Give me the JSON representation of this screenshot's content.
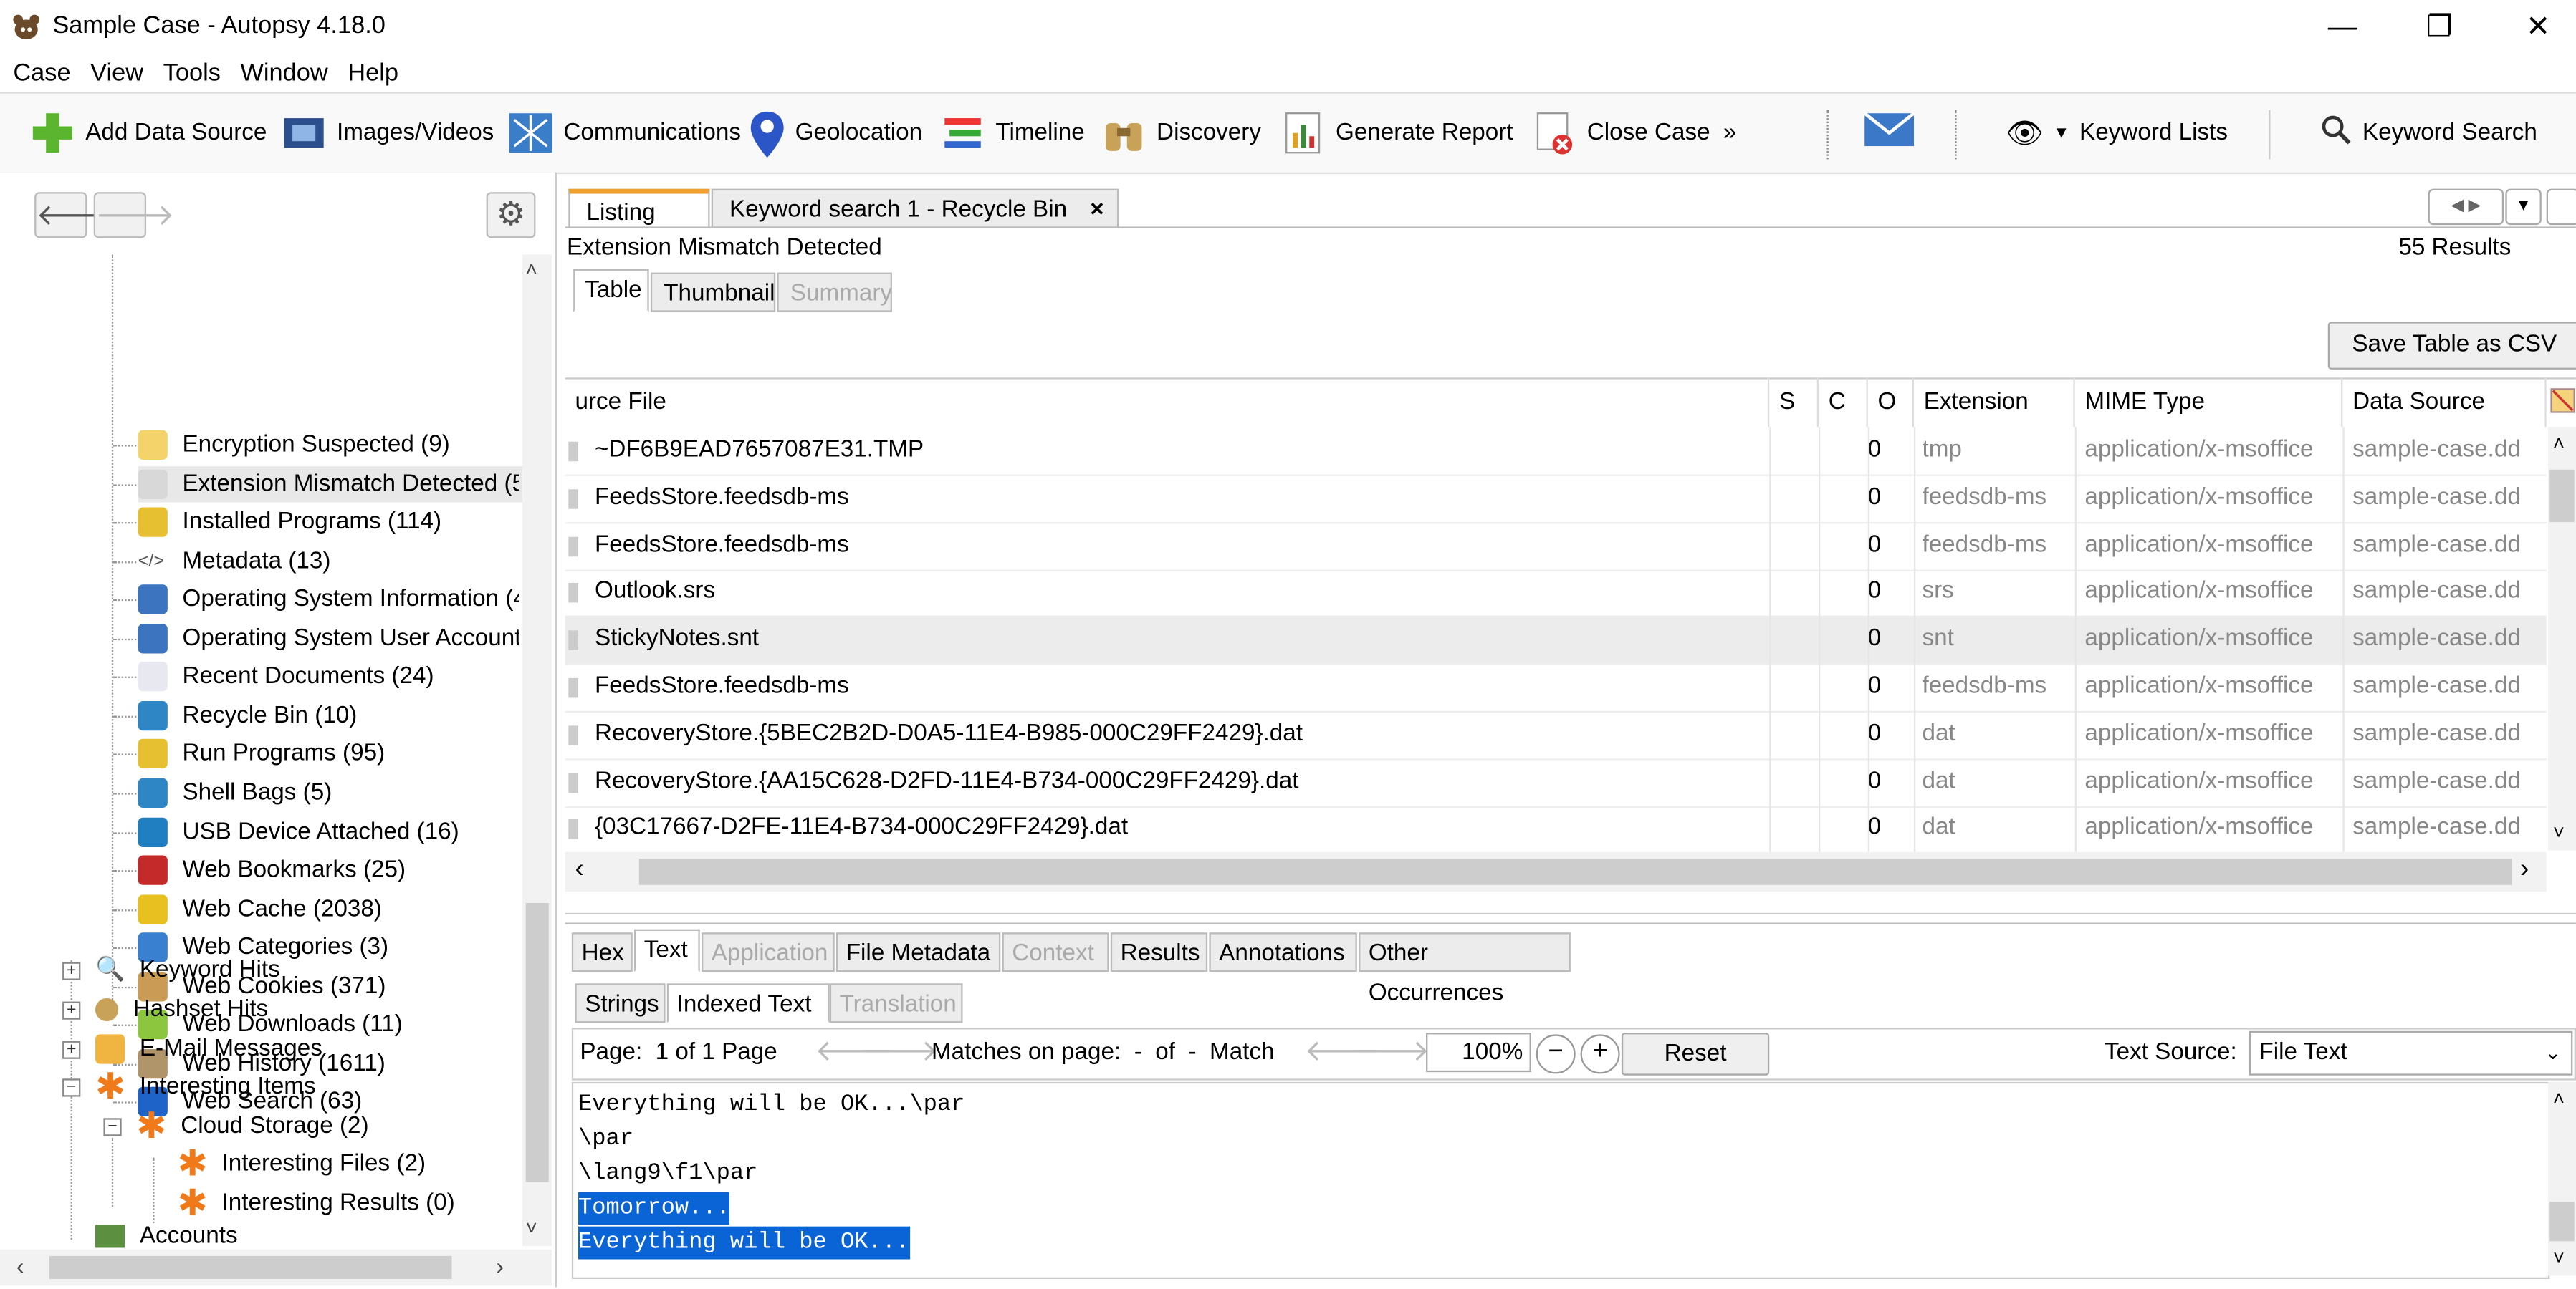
{
  "window": {
    "title": "Sample Case - Autopsy 4.18.0",
    "controls": [
      "—",
      "❐",
      "✕"
    ]
  },
  "menu": [
    "Case",
    "View",
    "Tools",
    "Window",
    "Help"
  ],
  "toolbar": {
    "add_data_source": "Add Data Source",
    "images_videos": "Images/Videos",
    "communications": "Communications",
    "geolocation": "Geolocation",
    "timeline": "Timeline",
    "discovery": "Discovery",
    "generate_report": "Generate Report",
    "close_case": "Close Case",
    "more": "»",
    "keyword_lists": "Keyword Lists",
    "keyword_search": "Keyword Search"
  },
  "tree": {
    "items": [
      {
        "label": "Encryption Suspected (9)",
        "icon": "encryption-icon"
      },
      {
        "label": "Extension Mismatch Detected (5",
        "icon": "mismatch-icon"
      },
      {
        "label": "Installed Programs (114)",
        "icon": "installed-programs-icon"
      },
      {
        "label": "Metadata (13)",
        "icon": "metadata-icon"
      },
      {
        "label": "Operating System Information (4",
        "icon": "os-info-icon"
      },
      {
        "label": "Operating System User Account",
        "icon": "os-user-icon"
      },
      {
        "label": "Recent Documents (24)",
        "icon": "recent-docs-icon"
      },
      {
        "label": "Recycle Bin (10)",
        "icon": "recycle-bin-icon"
      },
      {
        "label": "Run Programs (95)",
        "icon": "run-programs-icon"
      },
      {
        "label": "Shell Bags (5)",
        "icon": "shell-bags-icon"
      },
      {
        "label": "USB Device Attached (16)",
        "icon": "usb-icon"
      },
      {
        "label": "Web Bookmarks (25)",
        "icon": "bookmark-icon"
      },
      {
        "label": "Web Cache (2038)",
        "icon": "web-cache-icon"
      },
      {
        "label": "Web Categories (3)",
        "icon": "web-categories-icon"
      },
      {
        "label": "Web Cookies (371)",
        "icon": "cookie-icon"
      },
      {
        "label": "Web Downloads (11)",
        "icon": "download-icon"
      },
      {
        "label": "Web History (1611)",
        "icon": "hourglass-icon"
      },
      {
        "label": "Web Search (63)",
        "icon": "web-search-icon"
      }
    ],
    "groups": [
      {
        "label": "Keyword Hits",
        "icon": "magnifier-icon"
      },
      {
        "label": "Hashset Hits",
        "icon": "pin-icon"
      },
      {
        "label": "E-Mail Messages",
        "icon": "email-icon"
      },
      {
        "label": "Interesting Items",
        "icon": "asterisk-icon"
      }
    ],
    "cloud_storage": "Cloud Storage (2)",
    "interesting_files": "Interesting Files (2)",
    "interesting_results": "Interesting Results (0)",
    "accounts": "Accounts"
  },
  "tabs": {
    "listing": "Listing",
    "keyword_search": "Keyword search 1 - Recycle Bin",
    "close": "×"
  },
  "listing": {
    "title": "Extension Mismatch Detected",
    "results": "55  Results",
    "view_tabs": [
      "Table",
      "Thumbnail",
      "Summary"
    ],
    "save_csv": "Save Table as CSV",
    "columns": [
      "urce File",
      "S",
      "C",
      "O",
      "Extension",
      "MIME Type",
      "Data Source"
    ],
    "rows": [
      {
        "file": "~DF6B9EAD7657087E31.TMP",
        "o": "0",
        "ext": "tmp",
        "mime": "application/x-msoffice",
        "ds": "sample-case.dd"
      },
      {
        "file": "FeedsStore.feedsdb-ms",
        "o": "0",
        "ext": "feedsdb-ms",
        "mime": "application/x-msoffice",
        "ds": "sample-case.dd"
      },
      {
        "file": "FeedsStore.feedsdb-ms",
        "o": "0",
        "ext": "feedsdb-ms",
        "mime": "application/x-msoffice",
        "ds": "sample-case.dd"
      },
      {
        "file": "Outlook.srs",
        "o": "0",
        "ext": "srs",
        "mime": "application/x-msoffice",
        "ds": "sample-case.dd"
      },
      {
        "file": "StickyNotes.snt",
        "o": "0",
        "ext": "snt",
        "mime": "application/x-msoffice",
        "ds": "sample-case.dd"
      },
      {
        "file": "FeedsStore.feedsdb-ms",
        "o": "0",
        "ext": "feedsdb-ms",
        "mime": "application/x-msoffice",
        "ds": "sample-case.dd"
      },
      {
        "file": "RecoveryStore.{5BEC2B2D-D0A5-11E4-B985-000C29FF2429}.dat",
        "o": "0",
        "ext": "dat",
        "mime": "application/x-msoffice",
        "ds": "sample-case.dd"
      },
      {
        "file": "RecoveryStore.{AA15C628-D2FD-11E4-B734-000C29FF2429}.dat",
        "o": "0",
        "ext": "dat",
        "mime": "application/x-msoffice",
        "ds": "sample-case.dd"
      },
      {
        "file": "{03C17667-D2FE-11E4-B734-000C29FF2429}.dat",
        "o": "0",
        "ext": "dat",
        "mime": "application/x-msoffice",
        "ds": "sample-case.dd"
      }
    ]
  },
  "content": {
    "tabs": [
      "Hex",
      "Text",
      "Application",
      "File Metadata",
      "Context",
      "Results",
      "Annotations",
      "Other Occurrences"
    ],
    "sub_tabs": [
      "Strings",
      "Indexed Text",
      "Translation"
    ],
    "page": "Page:  1 of 1 Page",
    "matches": "Matches on page:  -  of  -  Match",
    "zoom": "100%",
    "reset": "Reset",
    "text_source_label": "Text Source:",
    "text_source_value": "File Text",
    "lines": [
      "Everything will be OK...\\par",
      "\\par",
      "\\lang9\\f1\\par",
      "Tomorrow...",
      "Everything will be OK..."
    ]
  },
  "colors": {
    "selection": "#0a64d6",
    "highlight_row": "#ececec",
    "accent_orange": "#f07a1a"
  }
}
